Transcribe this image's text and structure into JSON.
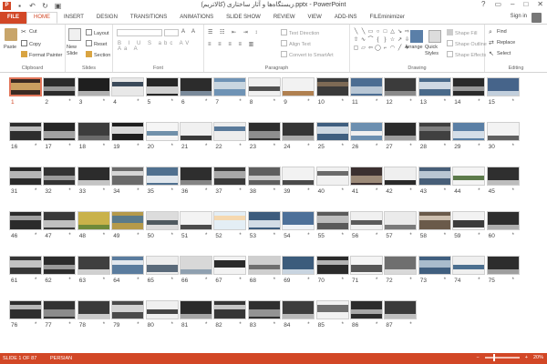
{
  "window": {
    "title": "زیستگاه‌ها و آثار ساختاری (کالاتریم).pptx - PowerPoint",
    "controls": [
      "?",
      "▭",
      "–",
      "□",
      "✕"
    ]
  },
  "qat": {
    "icons": [
      "powerpoint-icon",
      "save-icon",
      "undo-icon",
      "redo-icon",
      "present-icon"
    ]
  },
  "tabs": [
    "FILE",
    "HOME",
    "INSERT",
    "DESIGN",
    "TRANSITIONS",
    "ANIMATIONS",
    "SLIDE SHOW",
    "REVIEW",
    "VIEW",
    "ADD-INS",
    "FILEminimizer"
  ],
  "active_tab": "HOME",
  "account": {
    "signin": "Sign in"
  },
  "ribbon": {
    "clipboard": {
      "paste": "Paste",
      "cut": "Cut",
      "copy": "Copy",
      "format_painter": "Format Painter",
      "label": "Clipboard"
    },
    "slides": {
      "new_slide": "New Slide",
      "layout": "Layout",
      "reset": "Reset",
      "section": "Section",
      "label": "Slides"
    },
    "font": {
      "font_name": "",
      "font_size": "",
      "label": "Font"
    },
    "paragraph": {
      "text_direction": "Text Direction",
      "align_text": "Align Text",
      "convert_smartart": "Convert to SmartArt",
      "label": "Paragraph"
    },
    "drawing": {
      "arrange": "Arrange",
      "quick_styles": "Quick Styles",
      "shape_fill": "Shape Fill",
      "shape_outline": "Shape Outline",
      "shape_effects": "Shape Effects",
      "label": "Drawing"
    },
    "editing": {
      "find": "Find",
      "replace": "Replace",
      "select": "Select",
      "label": "Editing"
    }
  },
  "slides": [
    {
      "n": "1",
      "bg": "#3a2a22",
      "band": "#caa060",
      "star": ""
    },
    {
      "n": "2",
      "bg": "#2b2b2b",
      "band": "#9a9a9a",
      "star": "*"
    },
    {
      "n": "3",
      "bg": "#1f1f1f",
      "band": "#b0b0b0",
      "star": "*"
    },
    {
      "n": "4",
      "bg": "#e8e8e8",
      "band": "#3b4a5a",
      "star": "*"
    },
    {
      "n": "5",
      "bg": "#262626",
      "band": "#d0d0d0",
      "star": "*"
    },
    {
      "n": "6",
      "bg": "#2c2c2c",
      "band": "#7a8a9a",
      "star": "*"
    },
    {
      "n": "7",
      "bg": "#6f93b5",
      "band": "#c9d6e0",
      "star": "*"
    },
    {
      "n": "8",
      "bg": "#f0f0f0",
      "band": "#505050",
      "star": "*"
    },
    {
      "n": "9",
      "bg": "#f2f2f2",
      "band": "#b08050",
      "star": "*"
    },
    {
      "n": "10",
      "bg": "#3a3a3a",
      "band": "#7d6a55",
      "star": "*"
    },
    {
      "n": "11",
      "bg": "#4c6d92",
      "band": "#b8c6d4",
      "star": "*"
    },
    {
      "n": "12",
      "bg": "#3b3b3b",
      "band": "#8a8a8a",
      "star": "*"
    },
    {
      "n": "13",
      "bg": "#4a6a8a",
      "band": "#cfd9e3",
      "star": "*"
    },
    {
      "n": "14",
      "bg": "#2a2a2a",
      "band": "#999999",
      "star": "*"
    },
    {
      "n": "15",
      "bg": "#46648a",
      "band": "#c2cfdc",
      "star": "*"
    },
    {
      "n": "16",
      "bg": "#2d2d2d",
      "band": "#bcbcbc",
      "star": "*"
    },
    {
      "n": "17",
      "bg": "#262626",
      "band": "#a2a2a2",
      "star": "*"
    },
    {
      "n": "18",
      "bg": "#3d3d3d",
      "band": "#6a6a6a",
      "star": "*"
    },
    {
      "n": "19",
      "bg": "#1f1f1f",
      "band": "#d8d8d8",
      "star": "*"
    },
    {
      "n": "20",
      "bg": "#f5f5f5",
      "band": "#7090aa",
      "star": "*"
    },
    {
      "n": "21",
      "bg": "#f0f0f0",
      "band": "#3a3a3a",
      "star": "*"
    },
    {
      "n": "22",
      "bg": "#ededed",
      "band": "#5a7a9a",
      "star": "*"
    },
    {
      "n": "23",
      "bg": "#2e2e2e",
      "band": "#8e8e8e",
      "star": "*"
    },
    {
      "n": "24",
      "bg": "#353535",
      "band": "#aaaaaa",
      "star": "*"
    },
    {
      "n": "25",
      "bg": "#3f5f80",
      "band": "#cdd8e2",
      "star": "*"
    },
    {
      "n": "26",
      "bg": "#6c8fb0",
      "band": "#f0f0f0",
      "star": "*"
    },
    {
      "n": "27",
      "bg": "#2b2b2b",
      "band": "#9d9d9d",
      "star": "*"
    },
    {
      "n": "28",
      "bg": "#404040",
      "band": "#7f7f7f",
      "star": "*"
    },
    {
      "n": "29",
      "bg": "#5a7fa5",
      "band": "#d4dee8",
      "star": "*"
    },
    {
      "n": "30",
      "bg": "#f3f3f3",
      "band": "#606060",
      "star": "*"
    },
    {
      "n": "31",
      "bg": "#2a2a2a",
      "band": "#b5b5b5",
      "star": "*"
    },
    {
      "n": "32",
      "bg": "#333333",
      "band": "#9b9b9b",
      "star": "*"
    },
    {
      "n": "33",
      "bg": "#2c2c2c",
      "band": "#c4c4c4",
      "star": "*"
    },
    {
      "n": "34",
      "bg": "#6a6a6a",
      "band": "#d6d6d6",
      "star": "*"
    },
    {
      "n": "35",
      "bg": "#50708f",
      "band": "#e0e6ec",
      "star": "*"
    },
    {
      "n": "36",
      "bg": "#2e2e2e",
      "band": "#858585",
      "star": "*"
    },
    {
      "n": "37",
      "bg": "#3a3a3a",
      "band": "#a8a8a8",
      "star": "*"
    },
    {
      "n": "38",
      "bg": "#5e5e5e",
      "band": "#c8c8c8",
      "star": "*"
    },
    {
      "n": "39",
      "bg": "#f2f2f2",
      "band": "#4a4a4a",
      "star": "*"
    },
    {
      "n": "40",
      "bg": "#f1f1f1",
      "band": "#6b6b6b",
      "star": "*"
    },
    {
      "n": "41",
      "bg": "#3b3030",
      "band": "#9c8a78",
      "star": "*"
    },
    {
      "n": "42",
      "bg": "#efefef",
      "band": "#2a2a2a",
      "star": "*"
    },
    {
      "n": "43",
      "bg": "#475e78",
      "band": "#b9c6d3",
      "star": "*"
    },
    {
      "n": "44",
      "bg": "#f4f4f4",
      "band": "#5c7a4a",
      "star": "*"
    },
    {
      "n": "45",
      "bg": "#2f2f2f",
      "band": "#bdbdbd",
      "star": "*"
    },
    {
      "n": "46",
      "bg": "#2b2b2b",
      "band": "#a0a0a0",
      "star": "*"
    },
    {
      "n": "47",
      "bg": "#3a3a3a",
      "band": "#c0c0c0",
      "star": "*"
    },
    {
      "n": "48",
      "bg": "#c9b24a",
      "band": "#6f8a3a",
      "star": "*"
    },
    {
      "n": "49",
      "bg": "#b59a4a",
      "band": "#5a7a8a",
      "star": "*"
    },
    {
      "n": "50",
      "bg": "#dcdcdc",
      "band": "#505a60",
      "star": "*"
    },
    {
      "n": "51",
      "bg": "#f3f3f3",
      "band": "#4b4b4b",
      "star": "*"
    },
    {
      "n": "52",
      "bg": "#e4eef5",
      "band": "#f5d8b0",
      "star": "*"
    },
    {
      "n": "53",
      "bg": "#3d5c7d",
      "band": "#d2dce6",
      "star": "*"
    },
    {
      "n": "54",
      "bg": "#4d7099",
      "band": "#eef2f6",
      "star": "*"
    },
    {
      "n": "55",
      "bg": "#5a5a5a",
      "band": "#bdbdbd",
      "star": "*"
    },
    {
      "n": "56",
      "bg": "#f0f0f0",
      "band": "#5a5a5a",
      "star": "*"
    },
    {
      "n": "57",
      "bg": "#ebebeb",
      "band": "#7a7a7a",
      "star": "*"
    },
    {
      "n": "58",
      "bg": "#6a5a4a",
      "band": "#cdbfaf",
      "star": "*"
    },
    {
      "n": "59",
      "bg": "#f2f2f2",
      "band": "#3c3c3c",
      "star": "*"
    },
    {
      "n": "60",
      "bg": "#2e2e2e",
      "band": "#aeaeae",
      "star": "*"
    },
    {
      "n": "61",
      "bg": "#363636",
      "band": "#c2c2c2",
      "star": "*"
    },
    {
      "n": "62",
      "bg": "#2c2c2c",
      "band": "#9a9a9a",
      "star": "*"
    },
    {
      "n": "63",
      "bg": "#3f3f3f",
      "band": "#d0d0d0",
      "star": "*"
    },
    {
      "n": "64",
      "bg": "#5a7c9e",
      "band": "#e2e8ee",
      "star": "*"
    },
    {
      "n": "65",
      "bg": "#ededed",
      "band": "#5a6a7a",
      "star": "*"
    },
    {
      "n": "66",
      "bg": "#d8d8d8",
      "band": "#8fa0b0",
      "star": "*"
    },
    {
      "n": "67",
      "bg": "#f2f2f2",
      "band": "#2b2b2b",
      "star": "*"
    },
    {
      "n": "68",
      "bg": "#cfcfcf",
      "band": "#6f6f6f",
      "star": "*"
    },
    {
      "n": "69",
      "bg": "#3c5c7c",
      "band": "#c8d4e0",
      "star": "*"
    },
    {
      "n": "70",
      "bg": "#2a2a2a",
      "band": "#b2b2b2",
      "star": "*"
    },
    {
      "n": "71",
      "bg": "#f4f4f4",
      "band": "#575757",
      "star": "*"
    },
    {
      "n": "72",
      "bg": "#6f6f6f",
      "band": "#d9d9d9",
      "star": "*"
    },
    {
      "n": "73",
      "bg": "#405f7f",
      "band": "#a9bccc",
      "star": "*"
    },
    {
      "n": "74",
      "bg": "#efefef",
      "band": "#4c6f8f",
      "star": "*"
    },
    {
      "n": "75",
      "bg": "#2d2d2d",
      "band": "#9e9e9e",
      "star": "*"
    },
    {
      "n": "76",
      "bg": "#2e2e2e",
      "band": "#b7b7b7",
      "star": "*"
    },
    {
      "n": "77",
      "bg": "#333333",
      "band": "#8c8c8c",
      "star": "*"
    },
    {
      "n": "78",
      "bg": "#3a3a3a",
      "band": "#cacaca",
      "star": "*"
    },
    {
      "n": "79",
      "bg": "#4b4b4b",
      "band": "#d3d3d3",
      "star": "*"
    },
    {
      "n": "80",
      "bg": "#f0f0f0",
      "band": "#464646",
      "star": "*"
    },
    {
      "n": "81",
      "bg": "#2b2b2b",
      "band": "#a5a5a5",
      "star": "*"
    },
    {
      "n": "82",
      "bg": "#363636",
      "band": "#c6c6c6",
      "star": "*"
    },
    {
      "n": "83",
      "bg": "#2f2f2f",
      "band": "#939393",
      "star": "*"
    },
    {
      "n": "84",
      "bg": "#3d3d3d",
      "band": "#b9b9b9",
      "star": "*"
    },
    {
      "n": "85",
      "bg": "#f1f1f1",
      "band": "#6e6e6e",
      "star": "*"
    },
    {
      "n": "86",
      "bg": "#2c2c2c",
      "band": "#a8a8a8",
      "star": "*"
    },
    {
      "n": "87",
      "bg": "#3a3a3a",
      "band": "#bfbfbf",
      "star": "*"
    }
  ],
  "selected_slide": "1",
  "status": {
    "slide_info": "SLIDE 1 OF 87",
    "language": "PERSIAN",
    "zoom": "20%",
    "zoom_minus": "−",
    "zoom_plus": "+"
  },
  "colors": {
    "accent": "#d24726",
    "selected_border": "#e2765a"
  }
}
